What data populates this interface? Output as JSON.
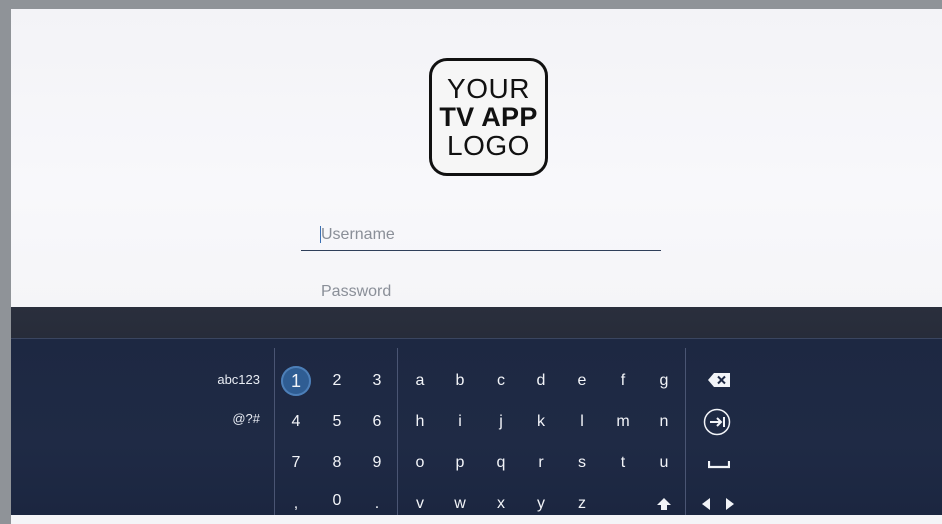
{
  "logo": {
    "line1": "YOUR",
    "line2": "TV APP",
    "line3": "LOGO"
  },
  "form": {
    "username_placeholder": "Username",
    "password_placeholder": "Password"
  },
  "keyboard": {
    "modes": {
      "alnum": "abc123",
      "symbols": "@?#"
    },
    "focused_key": "1",
    "number_rows": [
      [
        "1",
        "2",
        "3"
      ],
      [
        "4",
        "5",
        "6"
      ],
      [
        "7",
        "8",
        "9"
      ],
      [
        ",",
        "0",
        "."
      ]
    ],
    "letter_rows": [
      [
        "a",
        "b",
        "c",
        "d",
        "e",
        "f",
        "g"
      ],
      [
        "h",
        "i",
        "j",
        "k",
        "l",
        "m",
        "n"
      ],
      [
        "o",
        "p",
        "q",
        "r",
        "s",
        "t",
        "u"
      ],
      [
        "v",
        "w",
        "x",
        "y",
        "z"
      ]
    ],
    "icons": {
      "backspace": "backspace-icon",
      "tab_next": "tab-next-icon",
      "space": "space-icon",
      "shift": "shift-icon",
      "cursor_left": "cursor-left-icon",
      "cursor_right": "cursor-right-icon"
    }
  }
}
